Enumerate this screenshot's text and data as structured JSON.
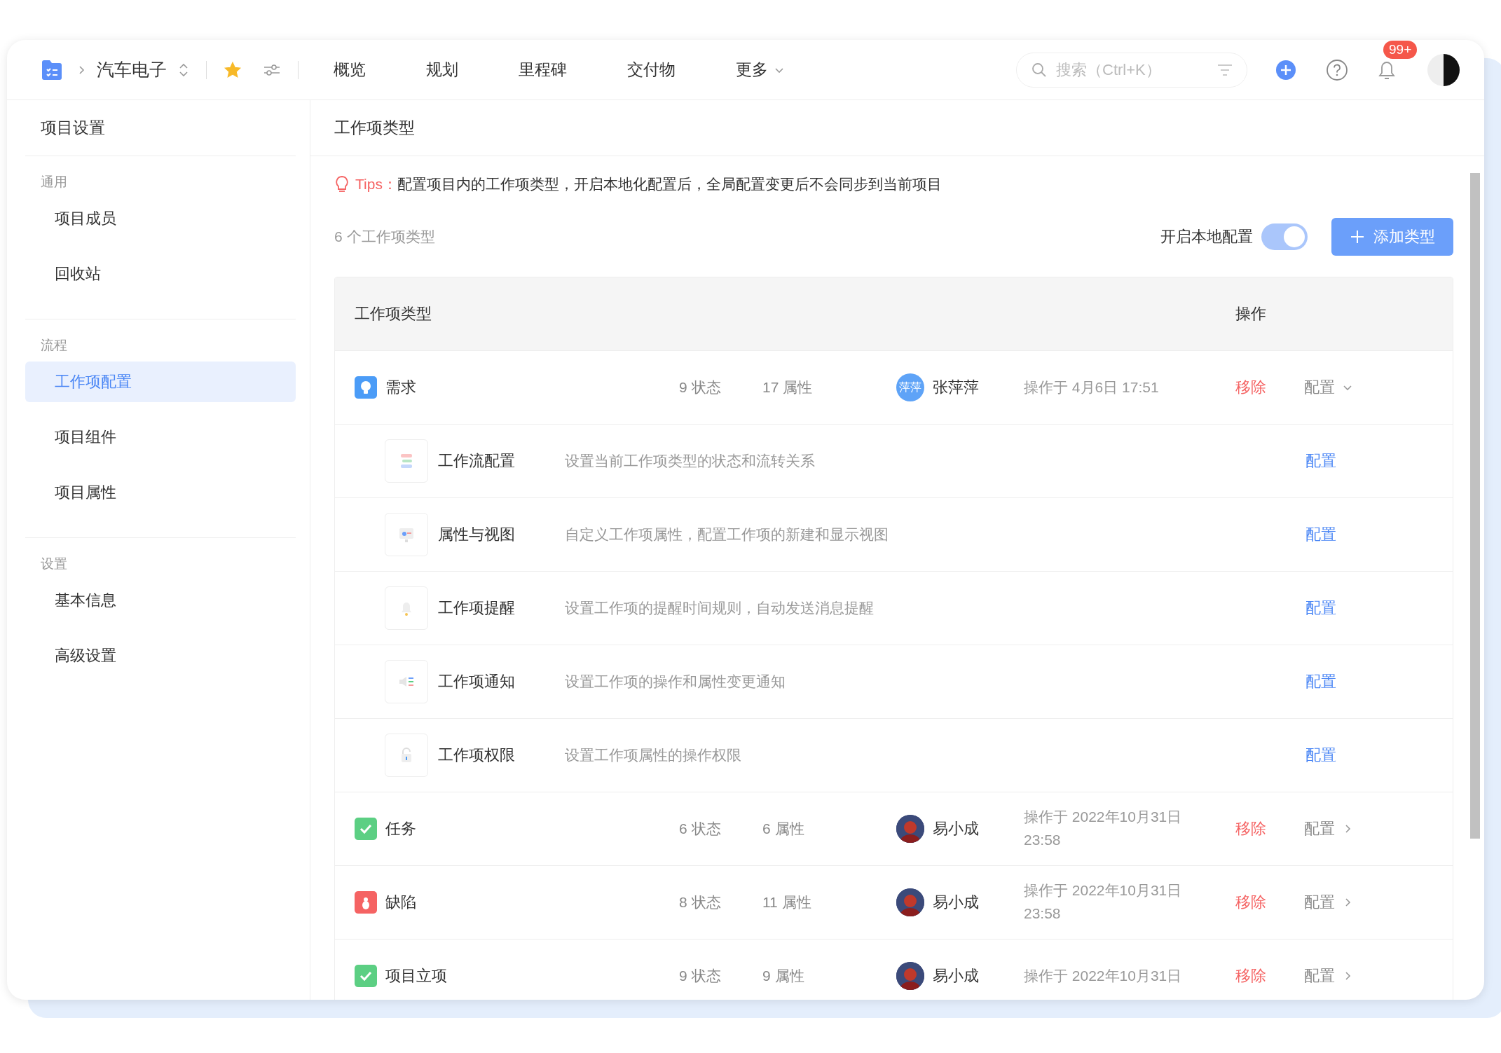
{
  "header": {
    "project": "汽车电子",
    "favorite": true,
    "nav": [
      "概览",
      "规划",
      "里程碑",
      "交付物"
    ],
    "more": "更多",
    "search": {
      "placeholder": "搜索（Ctrl+K）"
    },
    "badge": "99+"
  },
  "sidebar": {
    "title": "项目设置",
    "groups": [
      {
        "label": "通用",
        "items": [
          {
            "label": "项目成员",
            "selected": false
          },
          {
            "label": "回收站",
            "selected": false
          }
        ]
      },
      {
        "label": "流程",
        "items": [
          {
            "label": "工作项配置",
            "selected": true
          },
          {
            "label": "项目组件",
            "selected": false
          },
          {
            "label": "项目属性",
            "selected": false
          }
        ]
      },
      {
        "label": "设置",
        "items": [
          {
            "label": "基本信息",
            "selected": false
          },
          {
            "label": "高级设置",
            "selected": false
          }
        ]
      }
    ]
  },
  "content": {
    "title": "工作项类型",
    "tips_label": "Tips：",
    "tips": "配置项目内的工作项类型，开启本地化配置后，全局配置变更后不会同步到当前项目",
    "count": "6 个工作项类型",
    "local_config": {
      "label": "开启本地配置",
      "on": true
    },
    "add_button": "添加类型"
  },
  "table": {
    "columns": [
      "工作项类型",
      "操作"
    ],
    "rows": [
      {
        "kind": "requirement",
        "name": "需求",
        "states": "9 状态",
        "attrs": "17 属性",
        "user": {
          "name": "张萍萍",
          "avatar_text": "萍萍"
        },
        "time": "操作于 4月6日 17:51",
        "remove": "移除",
        "config": "配置",
        "expanded": true,
        "children": [
          {
            "kind": "workflow",
            "name": "工作流配置",
            "desc": "设置当前工作项类型的状态和流转关系",
            "action": "配置"
          },
          {
            "kind": "view",
            "name": "属性与视图",
            "desc": "自定义工作项属性，配置工作项的新建和显示视图",
            "action": "配置"
          },
          {
            "kind": "reminder",
            "name": "工作项提醒",
            "desc": "设置工作项的提醒时间规则，自动发送消息提醒",
            "action": "配置"
          },
          {
            "kind": "notice",
            "name": "工作项通知",
            "desc": "设置工作项的操作和属性变更通知",
            "action": "配置"
          },
          {
            "kind": "permission",
            "name": "工作项权限",
            "desc": "设置工作项属性的操作权限",
            "action": "配置"
          }
        ]
      },
      {
        "kind": "task",
        "name": "任务",
        "states": "6 状态",
        "attrs": "6 属性",
        "user": {
          "name": "易小成"
        },
        "time": "操作于 2022年10月31日 23:58",
        "remove": "移除",
        "config": "配置",
        "expanded": false
      },
      {
        "kind": "bug",
        "name": "缺陷",
        "states": "8 状态",
        "attrs": "11 属性",
        "user": {
          "name": "易小成"
        },
        "time": "操作于 2022年10月31日 23:58",
        "remove": "移除",
        "config": "配置",
        "expanded": false
      },
      {
        "kind": "task",
        "name": "项目立项",
        "states": "9 状态",
        "attrs": "9 属性",
        "user": {
          "name": "易小成"
        },
        "time": "操作于 2022年10月31日",
        "remove": "移除",
        "config": "配置",
        "expanded": false
      }
    ]
  }
}
